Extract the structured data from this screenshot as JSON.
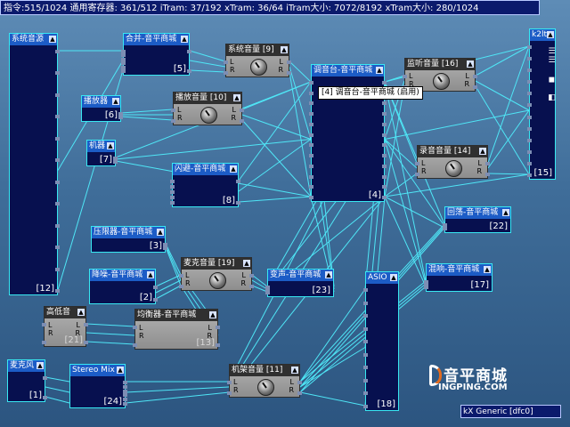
{
  "status_bar": "指令:515/1024 通用寄存器: 361/512 iTram: 37/192 xTram: 36/64 iTram大小: 7072/8192 xTram大小: 280/1024",
  "tooltip": "[4] 调音台-音平商城 (启用)",
  "device_status": "kX Generic [dfc0]",
  "logo": {
    "name": "音平商城",
    "url": "INGPING.COM"
  },
  "port_labels": {
    "l": "L",
    "r": "R"
  },
  "icons": {
    "minimize": "▲"
  },
  "nodes": [
    {
      "key": "sysin",
      "title": "系统音源",
      "index": "[12]",
      "style": "blue"
    },
    {
      "key": "merge",
      "title": "合并-音平商城",
      "index": "[5]",
      "style": "blue"
    },
    {
      "key": "sysvol",
      "title": "系统音量 [9]",
      "index": "",
      "style": "gray"
    },
    {
      "key": "player",
      "title": "播放器",
      "index": "[6]",
      "style": "blue"
    },
    {
      "key": "playvol",
      "title": "播放音量 [10]",
      "index": "",
      "style": "gray"
    },
    {
      "key": "mixer",
      "title": "调音台-音平商城",
      "index": "[4]",
      "style": "blue"
    },
    {
      "key": "monitor",
      "title": "监听音量 [16]",
      "index": "",
      "style": "gray"
    },
    {
      "key": "k2",
      "title": "k2lt",
      "index": "[15]",
      "style": "blue"
    },
    {
      "key": "machine",
      "title": "机器",
      "index": "[7]",
      "style": "blue"
    },
    {
      "key": "recvol",
      "title": "录音音量 [14]",
      "index": "",
      "style": "gray"
    },
    {
      "key": "flash",
      "title": "闪避-音平商城",
      "index": "[8]",
      "style": "blue"
    },
    {
      "key": "echo",
      "title": "回荡-音平商城",
      "index": "[22]",
      "style": "blue"
    },
    {
      "key": "comp",
      "title": "压限器-音平商城",
      "index": "[3]",
      "style": "blue"
    },
    {
      "key": "micvol",
      "title": "麦克音量 [19]",
      "index": "",
      "style": "gray"
    },
    {
      "key": "voice",
      "title": "变声-音平商城",
      "index": "[23]",
      "style": "blue"
    },
    {
      "key": "reverb",
      "title": "混响-音平商城",
      "index": "[17]",
      "style": "blue"
    },
    {
      "key": "denoise",
      "title": "降噪-音平商城",
      "index": "[2]",
      "style": "blue"
    },
    {
      "key": "asio",
      "title": "ASIO",
      "index": "[18]",
      "style": "blue"
    },
    {
      "key": "hilow",
      "title": "高低音",
      "index": "[21]",
      "style": "gray"
    },
    {
      "key": "eq",
      "title": "均衡器-音平商城",
      "index": "[13]",
      "style": "gray"
    },
    {
      "key": "mic",
      "title": "麦克风",
      "index": "[1]",
      "style": "blue"
    },
    {
      "key": "stereomix",
      "title": "Stereo Mix",
      "index": "[24]",
      "style": "blue"
    },
    {
      "key": "rackvol",
      "title": "机架音量 [11]",
      "index": "",
      "style": "gray"
    }
  ]
}
